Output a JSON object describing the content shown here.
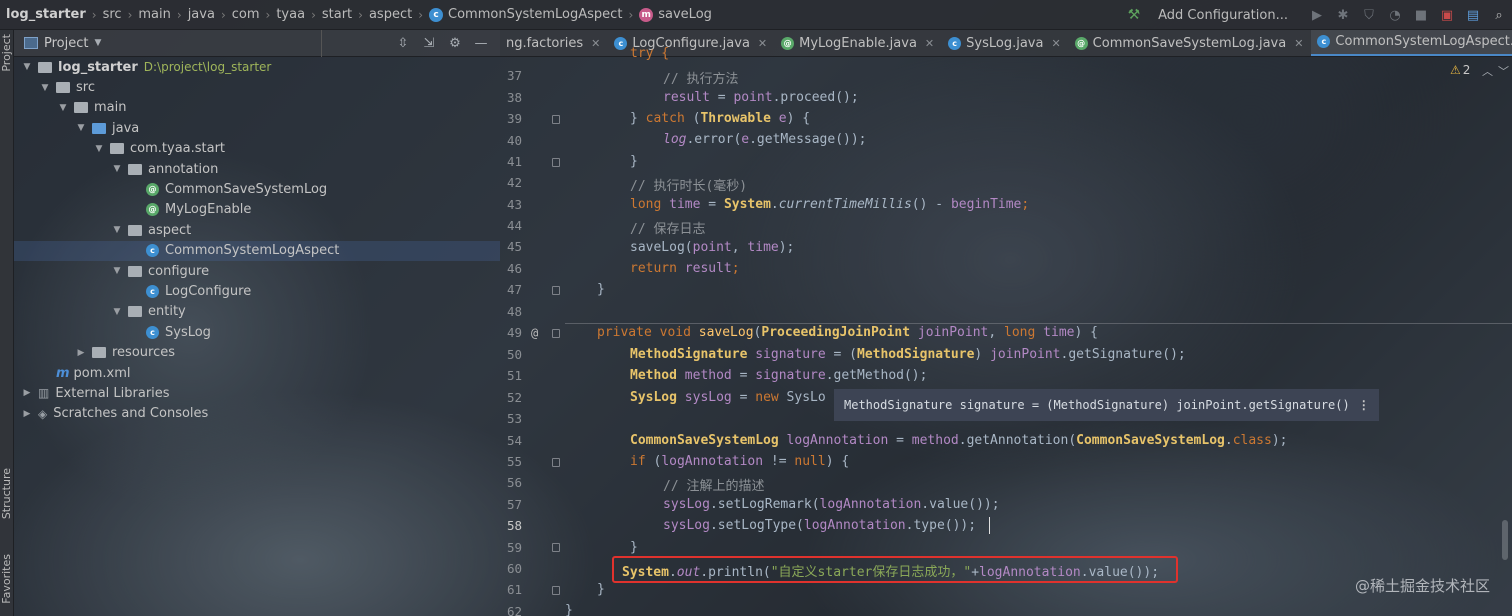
{
  "breadcrumbs": [
    "log_starter",
    "src",
    "main",
    "java",
    "com",
    "tyaa",
    "start",
    "aspect",
    "CommonSystemLogAspect",
    "saveLog"
  ],
  "toolbar": {
    "add_configuration": "Add Configuration..."
  },
  "left_strip": {
    "project": "Project",
    "structure": "Structure",
    "favorites": "Favorites"
  },
  "project_panel": {
    "title": "Project"
  },
  "tree": {
    "root_name": "log_starter",
    "root_path": "D:\\project\\log_starter",
    "src": "src",
    "main": "main",
    "java": "java",
    "pkg": "com.tyaa.start",
    "annotation": "annotation",
    "common_save": "CommonSaveSystemLog",
    "mylogenable": "MyLogEnable",
    "aspect": "aspect",
    "common_aspect": "CommonSystemLogAspect",
    "configure": "configure",
    "logconfigure": "LogConfigure",
    "entity": "entity",
    "syslog": "SysLog",
    "resources": "resources",
    "pom": "pom.xml",
    "ext_libs": "External Libraries",
    "scratches": "Scratches and Consoles"
  },
  "tabs": [
    {
      "label": "ng.factories",
      "icon": "none"
    },
    {
      "label": "LogConfigure.java",
      "icon": "class"
    },
    {
      "label": "MyLogEnable.java",
      "icon": "annotation"
    },
    {
      "label": "SysLog.java",
      "icon": "class"
    },
    {
      "label": "CommonSaveSystemLog.java",
      "icon": "annotation"
    },
    {
      "label": "CommonSystemLogAspect.java",
      "icon": "class"
    }
  ],
  "editor": {
    "line_numbers": [
      "37",
      "38",
      "39",
      "40",
      "41",
      "42",
      "43",
      "44",
      "45",
      "46",
      "47",
      "48",
      "49",
      "50",
      "51",
      "52",
      "53",
      "54",
      "55",
      "56",
      "57",
      "58",
      "59",
      "60",
      "61",
      "62"
    ],
    "current_line": "58",
    "warning_count": "2",
    "code": {
      "l36": "try {",
      "l37_comment": "// 执行方法",
      "l38_result": "result",
      "l38_eq": " = ",
      "l38_point": "point",
      "l38_call": ".proceed();",
      "l39_brace": "} ",
      "l39_catch": "catch",
      "l39_open": " (",
      "l39_type": "Throwable",
      "l39_e": " e",
      "l39_close": ") {",
      "l40_log": "log",
      "l40_error": ".error(",
      "l40_e": "e",
      "l40_rest": ".getMessage());",
      "l41": "}",
      "l42_comment": "// 执行时长(毫秒)",
      "l43_long": "long",
      "l43_time": " time",
      "l43_eq": " = ",
      "l43_system": "System",
      "l43_dot": ".",
      "l43_ctm": "currentTimeMillis",
      "l43_rest": "() - ",
      "l43_begin": "beginTime",
      "l43_semi": ";",
      "l44_comment": "// 保存日志",
      "l45_save": "saveLog(",
      "l45_point": "point",
      "l45_comma": ", ",
      "l45_time": "time",
      "l45_end": ");",
      "l46_return": "return",
      "l46_result": " result",
      "l46_semi": ";",
      "l47": "}",
      "l49_private": "private void ",
      "l49_name": "saveLog",
      "l49_open": "(",
      "l49_type": "ProceedingJoinPoint",
      "l49_jp": " joinPoint",
      "l49_comma": ", ",
      "l49_long": "long",
      "l49_time": " time",
      "l49_close": ") {",
      "l50_type": "MethodSignature",
      "l50_sig": " signature",
      "l50_eq": " = (",
      "l50_cast": "MethodSignature",
      "l50_paren": ") ",
      "l50_jp": "joinPoint",
      "l50_rest": ".getSignature();",
      "l51_type": "Method",
      "l51_m": " method",
      "l51_eq": " = ",
      "l51_sig": "signature",
      "l51_rest": ".getMethod();",
      "l52_type": "SysLog",
      "l52_var": " sysLog",
      "l52_eq": " = ",
      "l52_new": "new",
      "l52_rest": " SysLo",
      "l54_type": "CommonSaveSystemLog",
      "l54_var": " logAnnotation",
      "l54_eq": " = ",
      "l54_method": "method",
      "l54_get": ".getAnnotation(",
      "l54_cls": "CommonSaveSystemLog",
      "l54_dot": ".",
      "l54_class": "class",
      "l54_end": ");",
      "l55_if": "if",
      "l55_open": " (",
      "l55_var": "logAnnotation",
      "l55_ne": " != ",
      "l55_null": "null",
      "l55_close": ") {",
      "l56_comment": "// 注解上的描述",
      "l57_var": "sysLog",
      "l57_call": ".setLogRemark(",
      "l57_ann": "logAnnotation",
      "l57_rest": ".value());",
      "l58_var": "sysLog",
      "l58_call": ".setLogType(",
      "l58_ann": "logAnnotation",
      "l58_rest": ".type());",
      "l59": "}",
      "l60_system": "System",
      "l60_dot": ".",
      "l60_out": "out",
      "l60_println": ".println(",
      "l60_str": "\"自定义starter保存日志成功，\"",
      "l60_plus": "+",
      "l60_ann": "logAnnotation",
      "l60_rest": ".value());",
      "l61": "}",
      "l62": "}"
    },
    "tooltip": "MethodSignature signature = (MethodSignature) joinPoint.getSignature()"
  },
  "watermark": "@稀土掘金技术社区",
  "colors": {
    "keyword": "#cc7832",
    "type": "#e8c46a",
    "comment": "#8c9196",
    "field": "#b389c5",
    "highlight_box": "#e0322d",
    "active_tab": "#4a88c7"
  }
}
